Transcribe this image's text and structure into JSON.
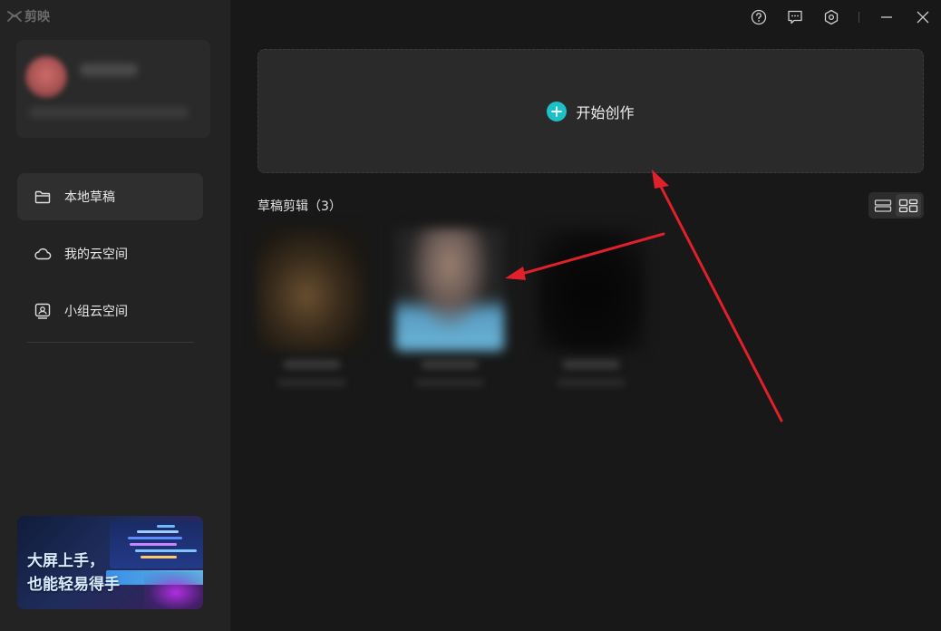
{
  "app": {
    "logo_text": "剪映"
  },
  "sidebar": {
    "items": [
      {
        "label": "本地草稿",
        "icon": "folder-icon",
        "active": true
      },
      {
        "label": "我的云空间",
        "icon": "cloud-icon",
        "active": false
      },
      {
        "label": "小组云空间",
        "icon": "team-cloud-icon",
        "active": false
      }
    ],
    "promo": {
      "line1": "大屏上手，",
      "line2": "也能轻易得手"
    }
  },
  "titlebar": {
    "icons": [
      "help-icon",
      "feedback-icon",
      "settings-icon",
      "minimize-icon",
      "close-icon"
    ]
  },
  "main": {
    "start_label": "开始创作",
    "drafts_title": "草稿剪辑（3）",
    "view_modes": [
      "list-view-icon",
      "grid-view-icon"
    ]
  },
  "colors": {
    "accent": "#1ec0c8",
    "annotation_arrow": "#e0202a",
    "sidebar_bg": "#232323",
    "main_bg": "#181818"
  }
}
